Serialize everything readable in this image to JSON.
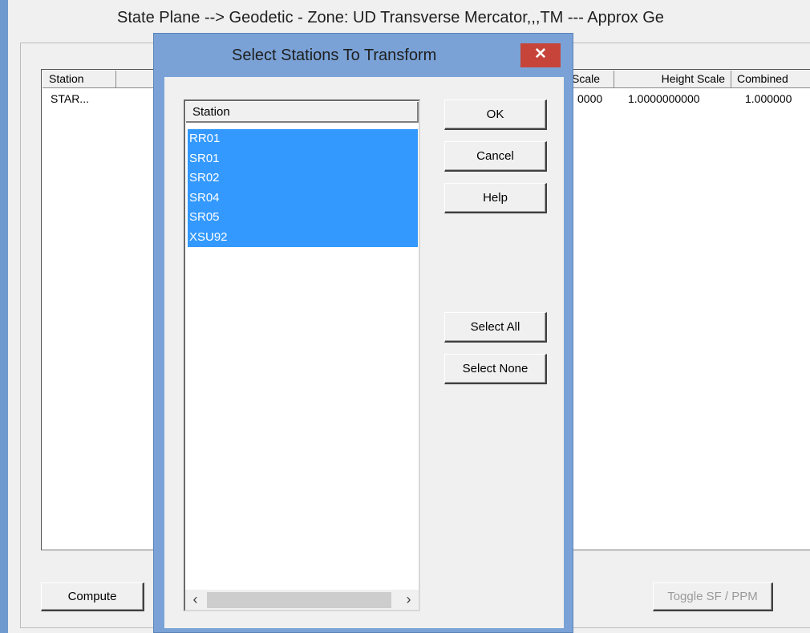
{
  "background_window": {
    "title": "State Plane --> Geodetic - Zone: UD Transverse Mercator,,,TM --- Approx Ge",
    "columns": [
      "Station",
      "Scale",
      "Height Scale",
      "Combined"
    ],
    "row": {
      "station": "STAR...",
      "scale": "0000",
      "height_scale": "1.0000000000",
      "combined": "1.000000"
    },
    "compute_label": "Compute",
    "toggle_label": "Toggle SF / PPM"
  },
  "dialog": {
    "title": "Select Stations To Transform",
    "close_glyph": "✕",
    "list_header": "Station",
    "stations": [
      "RR01",
      "SR01",
      "SR02",
      "SR04",
      "SR05",
      "XSU92"
    ],
    "buttons": {
      "ok": "OK",
      "cancel": "Cancel",
      "help": "Help",
      "select_all": "Select All",
      "select_none": "Select None"
    },
    "scroll_left": "‹",
    "scroll_right": "›",
    "selection_color": "#3399ff",
    "frame_color": "#7aa2d6",
    "close_color": "#c7443b"
  }
}
